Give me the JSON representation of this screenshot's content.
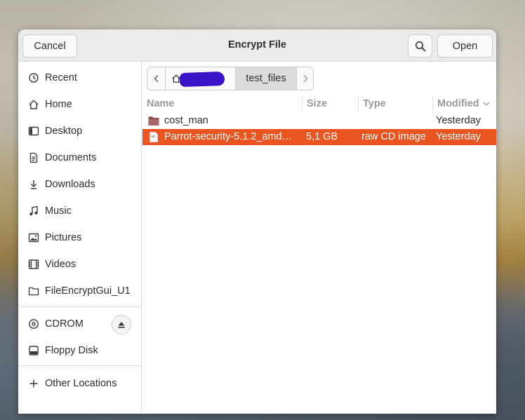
{
  "dialog": {
    "title": "Encrypt File",
    "cancel_label": "Cancel",
    "open_label": "Open"
  },
  "sidebar": {
    "places": [
      {
        "label": "Recent",
        "icon": "clock-icon"
      },
      {
        "label": "Home",
        "icon": "home-icon"
      },
      {
        "label": "Desktop",
        "icon": "desktop-icon"
      },
      {
        "label": "Documents",
        "icon": "document-icon"
      },
      {
        "label": "Downloads",
        "icon": "download-icon"
      },
      {
        "label": "Music",
        "icon": "music-icon"
      },
      {
        "label": "Pictures",
        "icon": "picture-icon"
      },
      {
        "label": "Videos",
        "icon": "video-icon"
      },
      {
        "label": "FileEncryptGui_U1",
        "icon": "folder-icon"
      }
    ],
    "devices": [
      {
        "label": "CDROM",
        "icon": "disc-icon"
      },
      {
        "label": "Floppy Disk",
        "icon": "drive-icon"
      }
    ],
    "other": {
      "label": "Other Locations",
      "icon": "plus-icon"
    }
  },
  "pathbar": {
    "segments": [
      "test_files"
    ],
    "current": "test_files"
  },
  "filelist": {
    "columns": {
      "name": "Name",
      "size": "Size",
      "type": "Type",
      "modified": "Modified"
    },
    "sort": {
      "column": "Modified",
      "direction": "descending"
    },
    "rows": [
      {
        "name": "cost_man",
        "size": "",
        "type": "",
        "modified": "Yesterday",
        "kind": "folder",
        "selected": false
      },
      {
        "name": "Parrot-security-5.1.2_amd…",
        "size": "5,1 GB",
        "type": "raw CD image",
        "modified": "Yesterday",
        "kind": "file",
        "selected": true
      }
    ]
  },
  "colors": {
    "accent": "#e95420",
    "headerbar": "#ebebeb",
    "redaction": "#3a12c8"
  }
}
